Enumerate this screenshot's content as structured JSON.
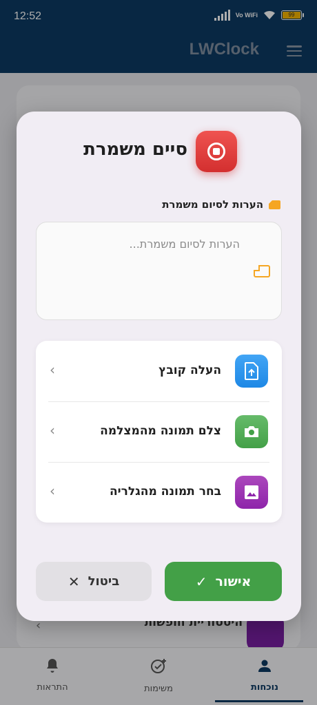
{
  "status_bar": {
    "time": "12:52",
    "network": "Vo WiFi",
    "battery": "99"
  },
  "app_bar": {
    "title": "LWClock"
  },
  "background": {
    "row_label": "היסטוריית חופשות"
  },
  "bottom_nav": {
    "items": [
      {
        "label": "התראות",
        "icon": "bell-icon"
      },
      {
        "label": "משימות",
        "icon": "task-check-icon"
      },
      {
        "label": "נוכחות",
        "icon": "person-icon"
      }
    ],
    "active": "נוכחות"
  },
  "dialog": {
    "title": "סיים משמרת",
    "icon": "stop-icon",
    "notes": {
      "label": "הערות לסיום משמרת",
      "placeholder": "הערות לסיום משמרת..."
    },
    "options": [
      {
        "label": "העלה קובץ",
        "icon": "file-upload-icon",
        "color": "#1e88e5"
      },
      {
        "label": "צלם תמונה מהמצלמה",
        "icon": "camera-icon",
        "color": "#43a047"
      },
      {
        "label": "בחר תמונה מהגלריה",
        "icon": "gallery-icon",
        "color": "#8e24aa"
      }
    ],
    "confirm_label": "אישור",
    "cancel_label": "ביטול"
  },
  "colors": {
    "primary": "#0c3a63",
    "danger": "#d32f2f",
    "success": "#43a047",
    "accent": "#f5a623"
  }
}
